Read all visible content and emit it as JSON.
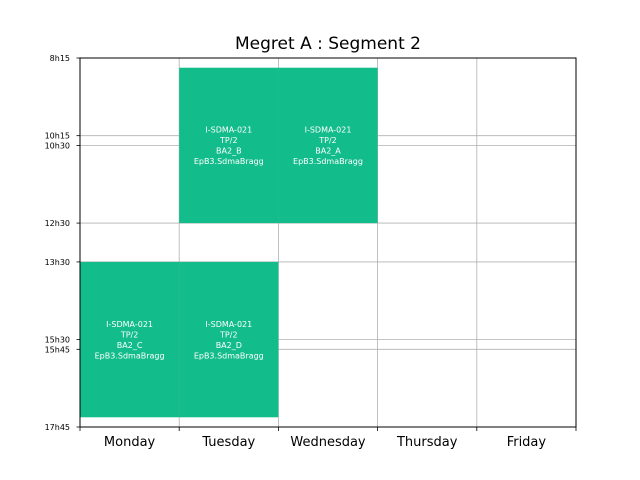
{
  "chart_data": {
    "type": "timetable",
    "title": "Megret A : Segment 2",
    "days": [
      "Monday",
      "Tuesday",
      "Wednesday",
      "Thursday",
      "Friday"
    ],
    "ylim": [
      "8h15",
      "17h45"
    ],
    "yticks": [
      "8h15",
      "10h15",
      "10h30",
      "12h30",
      "13h30",
      "15h30",
      "15h45",
      "17h45"
    ],
    "grid": true,
    "event_color": "#12bc8b",
    "events": [
      {
        "day": "Tuesday",
        "start": "8h30",
        "end": "12h30",
        "lines": [
          "I-SDMA-021",
          "TP/2",
          "BA2_B",
          "EpB3.SdmaBragg"
        ]
      },
      {
        "day": "Wednesday",
        "start": "8h30",
        "end": "12h30",
        "lines": [
          "I-SDMA-021",
          "TP/2",
          "BA2_A",
          "EpB3.SdmaBragg"
        ]
      },
      {
        "day": "Monday",
        "start": "13h30",
        "end": "17h30",
        "lines": [
          "I-SDMA-021",
          "TP/2",
          "BA2_C",
          "EpB3.SdmaBragg"
        ]
      },
      {
        "day": "Tuesday",
        "start": "13h30",
        "end": "17h30",
        "lines": [
          "I-SDMA-021",
          "TP/2",
          "BA2_D",
          "EpB3.SdmaBragg"
        ]
      }
    ]
  }
}
